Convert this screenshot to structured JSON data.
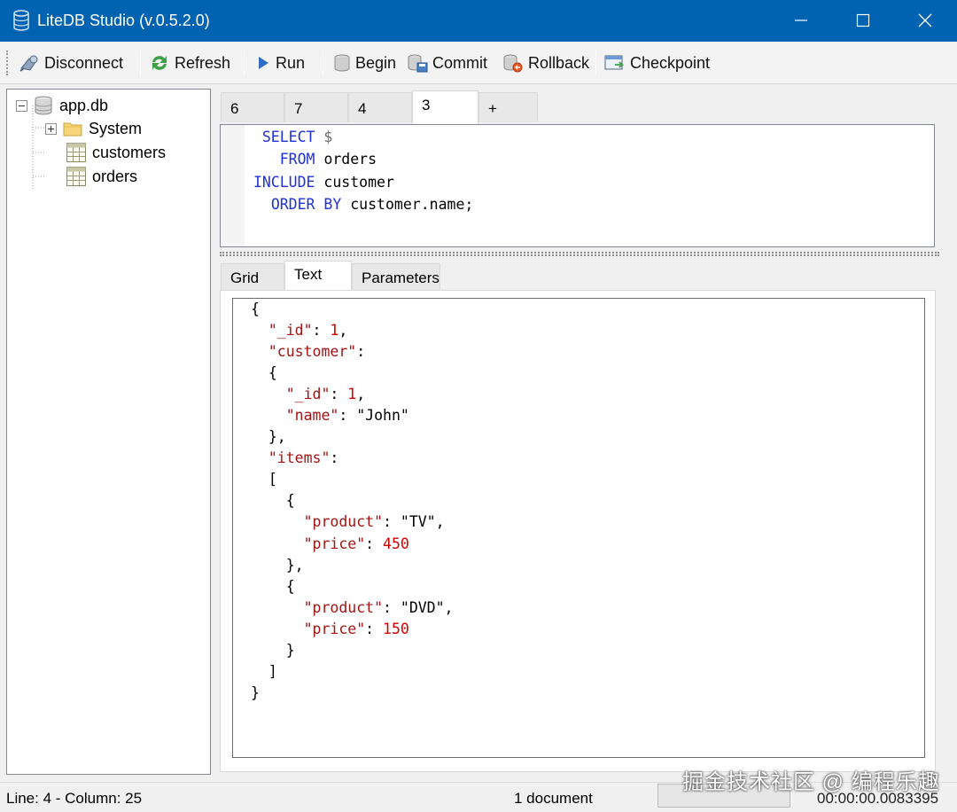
{
  "window": {
    "title": "LiteDB Studio (v.0.5.2.0)",
    "colors": {
      "titlebar": "#0063b1",
      "keyword": "#1f31d8",
      "json_key": "#a31515",
      "json_number": "#d40000"
    }
  },
  "toolbar": {
    "disconnect": "Disconnect",
    "refresh": "Refresh",
    "run": "Run",
    "begin": "Begin",
    "commit": "Commit",
    "rollback": "Rollback",
    "checkpoint": "Checkpoint"
  },
  "tree": {
    "root": "app.db",
    "system": "System",
    "customers": "customers",
    "orders": "orders"
  },
  "query_tabs": [
    "6",
    "7",
    "4",
    "3",
    "+"
  ],
  "query_tab_active": "3",
  "editor": {
    "lines": [
      {
        "indent": "  ",
        "kw": "SELECT",
        "space": " ",
        "sym": "$",
        "rest": ""
      },
      {
        "indent": "    ",
        "kw": "FROM",
        "space": " ",
        "sym": "",
        "rest": "orders"
      },
      {
        "indent": " ",
        "kw": "INCLUDE",
        "space": " ",
        "sym": "",
        "rest": "customer"
      },
      {
        "indent": "   ",
        "kw": "ORDER BY",
        "space": " ",
        "sym": "",
        "rest": "customer.name;"
      }
    ]
  },
  "result_tabs": [
    "Grid",
    "Text",
    "Parameters"
  ],
  "result_tab_active": "Text",
  "result_json": [
    {
      "i": "",
      "k": "",
      "n": "",
      "t": "{"
    },
    {
      "i": "  ",
      "k": "\"_id\"",
      "n": "1",
      "t": ": |,"
    },
    {
      "i": "  ",
      "k": "\"customer\"",
      "n": "",
      "t": ":"
    },
    {
      "i": "  ",
      "k": "",
      "n": "",
      "t": "{"
    },
    {
      "i": "    ",
      "k": "\"_id\"",
      "n": "1",
      "t": ": |,"
    },
    {
      "i": "    ",
      "k": "\"name\"",
      "n": "",
      "t": ": \"John\""
    },
    {
      "i": "  ",
      "k": "",
      "n": "",
      "t": "},"
    },
    {
      "i": "  ",
      "k": "\"items\"",
      "n": "",
      "t": ":"
    },
    {
      "i": "  ",
      "k": "",
      "n": "",
      "t": "["
    },
    {
      "i": "    ",
      "k": "",
      "n": "",
      "t": "{"
    },
    {
      "i": "      ",
      "k": "\"product\"",
      "n": "",
      "t": ": \"TV\","
    },
    {
      "i": "      ",
      "k": "\"price\"",
      "n": "450",
      "t": ": |"
    },
    {
      "i": "    ",
      "k": "",
      "n": "",
      "t": "},"
    },
    {
      "i": "    ",
      "k": "",
      "n": "",
      "t": "{"
    },
    {
      "i": "      ",
      "k": "\"product\"",
      "n": "",
      "t": ": \"DVD\","
    },
    {
      "i": "      ",
      "k": "\"price\"",
      "n": "150",
      "t": ": |"
    },
    {
      "i": "    ",
      "k": "",
      "n": "",
      "t": "}"
    },
    {
      "i": "  ",
      "k": "",
      "n": "",
      "t": "]"
    },
    {
      "i": "",
      "k": "",
      "n": "",
      "t": "}"
    }
  ],
  "status": {
    "position": "Line: 4 - Column: 25",
    "count": "1 document",
    "elapsed": "00:00:00.0083395"
  },
  "watermark": "掘金技术社区 @ 编程乐趣"
}
